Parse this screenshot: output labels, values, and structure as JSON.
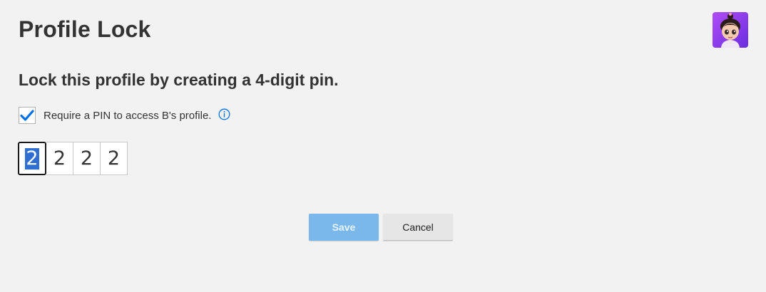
{
  "header": {
    "title": "Profile Lock"
  },
  "avatar": {
    "icon": "profile-avatar-icon",
    "background": "#8a3cf0"
  },
  "form": {
    "subtitle": "Lock this profile by creating a 4-digit pin.",
    "require_pin": {
      "checked": true,
      "label": "Require a PIN to access B's profile.",
      "info_icon": "info-icon"
    },
    "pin_digits": [
      "2",
      "2",
      "2",
      "2"
    ]
  },
  "actions": {
    "save_label": "Save",
    "cancel_label": "Cancel"
  },
  "colors": {
    "background": "#f2f2f2",
    "accent": "#0071eb",
    "save_button": "#7ab8ec",
    "cancel_button": "#e6e6e6",
    "selection": "#2f6fd1"
  }
}
